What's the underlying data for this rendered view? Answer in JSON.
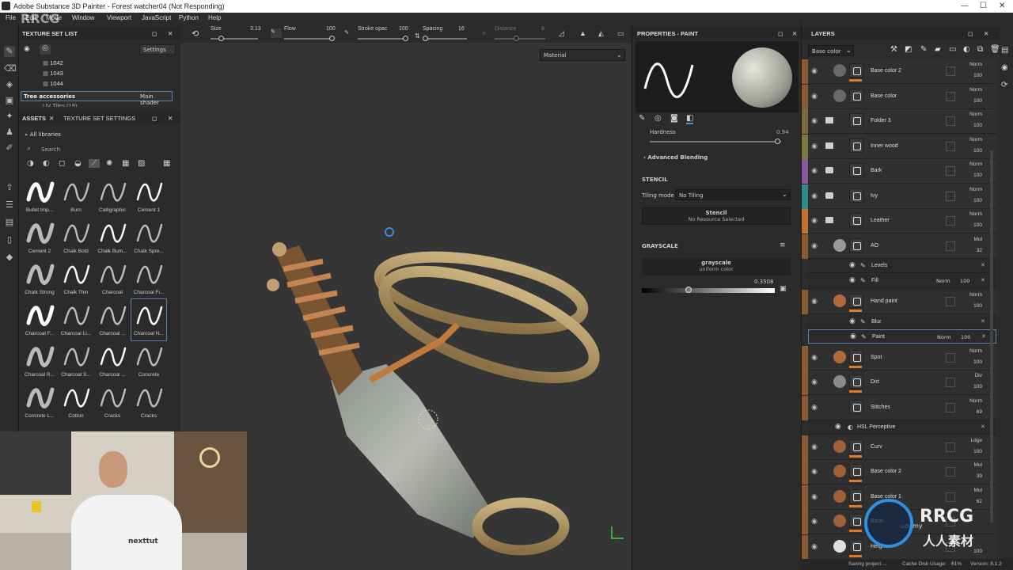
{
  "window": {
    "title": "Adobe Substance 3D Painter - Forest watcher04 (Not Responding)"
  },
  "menu": [
    "File",
    "Edit",
    "Mode",
    "Window",
    "Viewport",
    "JavaScript",
    "Python",
    "Help"
  ],
  "texture_set_list": {
    "title": "TEXTURE SET LIST",
    "settings_label": "Settings",
    "items": [
      "1042",
      "1043",
      "1044"
    ],
    "selected": {
      "name": "Tree accessories",
      "shader": "Main shader"
    },
    "cut_item": "UV Tiles (19)"
  },
  "assets": {
    "tab_assets": "ASSETS",
    "tab_settings": "TEXTURE SET SETTINGS",
    "library": "All libraries",
    "search_placeholder": "Search",
    "brushes": [
      "Bullet Imp...",
      "Burn",
      "Calligraphic",
      "Cement 1",
      "Cement 2",
      "Chalk Bold",
      "Chalk Bum...",
      "Chalk Spre...",
      "Chalk Strong",
      "Chalk Thin",
      "Charcoal",
      "Charcoal Fi...",
      "Charcoal F...",
      "Charcoal Li...",
      "Charcoal ...",
      "Charcoal N...",
      "Charcoal R...",
      "Charcoal S...",
      "Charcoal ...",
      "Concrete",
      "Concrete L...",
      "Cotton",
      "Cracks",
      "Cracks"
    ]
  },
  "tool_options": {
    "size_label": "Size",
    "size_value": "3.13",
    "flow_label": "Flow",
    "flow_value": "100",
    "stroke_label": "Stroke opac",
    "stroke_value": "100",
    "spacing_label": "Spacing",
    "spacing_value": "16",
    "distance_label": "Distance",
    "distance_value": "8",
    "view_mode": "Material"
  },
  "properties": {
    "title": "PROPERTIES - PAINT",
    "hardness_label": "Hardness",
    "hardness_value": "0.94",
    "advanced_blending": "Advanced Blending",
    "stencil_section": "STENCIL",
    "tiling_label": "Tiling mode",
    "tiling_value": "No Tiling",
    "stencil_name": "Stencil",
    "stencil_status": "No Resource Selected",
    "grayscale_section": "GRAYSCALE",
    "grayscale_name": "grayscale",
    "grayscale_type": "uniform color",
    "grayscale_value": "0.3508"
  },
  "layers": {
    "title": "LAYERS",
    "channel": "Base color",
    "rows": [
      {
        "name": "Base color 2",
        "blend": "Norm",
        "opacity": "100",
        "strip": "#8a5a30"
      },
      {
        "name": "Base color",
        "blend": "Norm",
        "opacity": "100",
        "strip": "#8a5a30"
      },
      {
        "name": "Folder 3",
        "blend": "Norm",
        "opacity": "100",
        "strip": "#7a6a3a"
      },
      {
        "name": "Inner wood",
        "blend": "Norm",
        "opacity": "100",
        "strip": "#7a7a3a"
      },
      {
        "name": "Bark",
        "blend": "Norm",
        "opacity": "100",
        "strip": "#8a5a9a"
      },
      {
        "name": "Ivy",
        "blend": "Norm",
        "opacity": "100",
        "strip": "#2f8a8a"
      },
      {
        "name": "Leather",
        "blend": "Norm",
        "opacity": "100",
        "strip": "#c27030"
      },
      {
        "name": "AO",
        "blend": "Mul",
        "opacity": "32",
        "strip": "#8a5a30"
      }
    ],
    "ao_subs": [
      {
        "name": "Levels"
      },
      {
        "name": "Fill",
        "blend": "Norm",
        "opacity": "100"
      }
    ],
    "hand_paint": {
      "name": "Hand paint",
      "blend": "Norm",
      "opacity": "100"
    },
    "hand_subs": [
      {
        "name": "Blur"
      },
      {
        "name": "Paint",
        "blend": "Norm",
        "opacity": "100"
      }
    ],
    "rows2": [
      {
        "name": "Spot",
        "blend": "Norm",
        "opacity": "100"
      },
      {
        "name": "Dirt",
        "blend": "Div",
        "opacity": "100"
      },
      {
        "name": "Stitches",
        "blend": "Norm",
        "opacity": "69"
      }
    ],
    "stitch_sub": "HSL Perceptive",
    "rows3": [
      {
        "name": "Curv",
        "blend": "Ldge",
        "opacity": "100"
      },
      {
        "name": "Base color 2",
        "blend": "Mul",
        "opacity": "39"
      },
      {
        "name": "Base color 1",
        "blend": "Mul",
        "opacity": "62"
      },
      {
        "name": "Base...",
        "blend": "",
        "opacity": ""
      },
      {
        "name": "Heigh...",
        "blend": "",
        "opacity": "100"
      }
    ]
  },
  "status": {
    "saving": "Saving project ...",
    "cache": "Cache Disk Usage:",
    "cache_value": "61%",
    "version": "Version: 8.1.2"
  },
  "watermarks": {
    "udemy": "udemy",
    "rrcg": "RRCG",
    "rrcg_cn": "人人素材",
    "shirt": "nexttut"
  }
}
